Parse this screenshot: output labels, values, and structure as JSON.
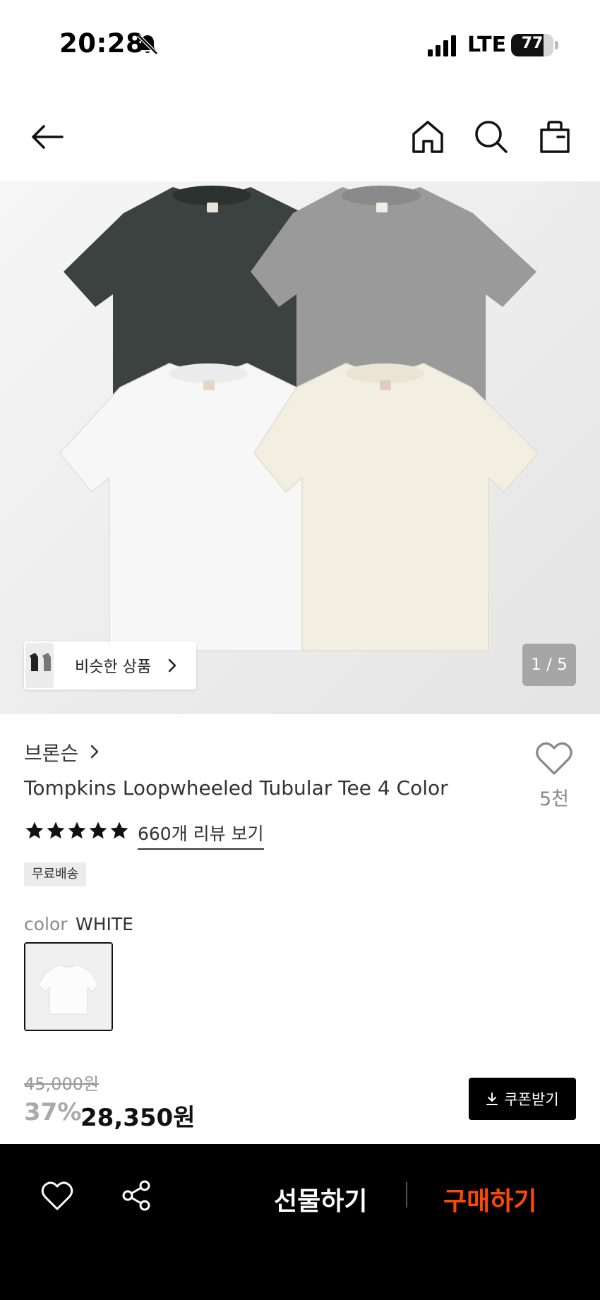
{
  "status_bar": {
    "time": "20:28",
    "network": "LTE",
    "battery_level": 77,
    "battery_text": "77"
  },
  "header": {
    "icons": [
      "back-arrow-icon",
      "home-icon",
      "search-icon",
      "shopping-bag-icon"
    ]
  },
  "gallery": {
    "similar_label": "비슷한 상품",
    "counter": "1 / 5",
    "current_slide": 1,
    "total_slides": 5
  },
  "product": {
    "brand": "브론슨",
    "title": "Tompkins Loopwheeled Tubular Tee 4 Color",
    "likes": "5천",
    "rating_stars": 5,
    "reviews_link": "660개 리뷰 보기",
    "shipping_badge": "무료배송",
    "color_label": "color",
    "color_value": "WHITE"
  },
  "pricing": {
    "original_price": "45,000원",
    "discount": "37%",
    "sale_price": "28,350원",
    "coupon_button": "쿠폰받기"
  },
  "bottom_bar": {
    "gift_label": "선물하기",
    "buy_label": "구매하기"
  },
  "colors": {
    "accent": "#ff4800",
    "black": "#000000"
  }
}
